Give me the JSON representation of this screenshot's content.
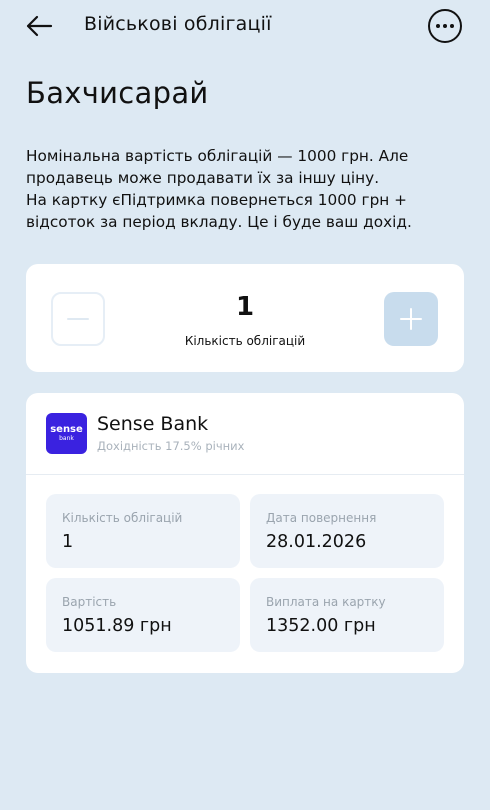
{
  "header": {
    "title": "Військові облігації"
  },
  "page": {
    "title": "Бахчисарай",
    "description_lines": [
      "Номінальна вартість облігацій — 1000 грн. Але",
      "продавець може продавати їх за іншу ціну.",
      "На картку єПідтримка повернеться 1000 грн +",
      "відсоток за період вкладу. Це і буде ваш дохід."
    ]
  },
  "quantity": {
    "value": "1",
    "label": "Кількість облігацій"
  },
  "bank": {
    "logo_line1": "sense",
    "logo_line2": "bank",
    "name": "Sense Bank",
    "yield": "Дохідність 17.5% річних",
    "tiles": [
      {
        "label": "Кількість облігацій",
        "value": "1"
      },
      {
        "label": "Дата повернення",
        "value": "28.01.2026"
      },
      {
        "label": "Вартість",
        "value": "1051.89 грн"
      },
      {
        "label": "Виплата на картку",
        "value": "1352.00 грн"
      }
    ]
  },
  "colors": {
    "background": "#dde9f3",
    "card": "#ffffff",
    "tile": "#eef3f9",
    "bank_brand": "#3a22e0",
    "plus_button": "#c8dced"
  },
  "icons": {
    "back": "arrow-left-icon",
    "more": "more-horizontal-icon",
    "minus": "minus-icon",
    "plus": "plus-icon"
  }
}
